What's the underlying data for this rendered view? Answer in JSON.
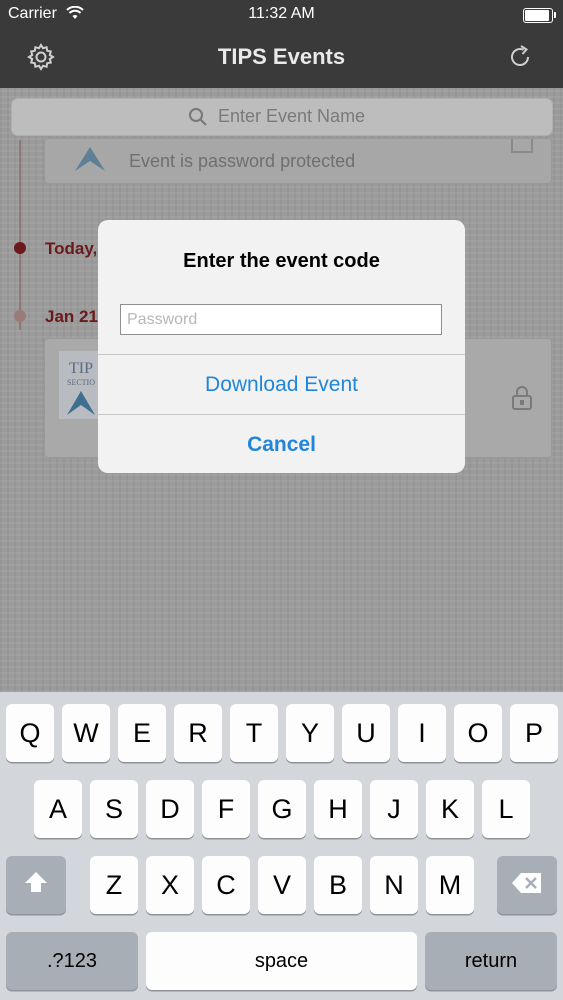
{
  "status_bar": {
    "carrier": "Carrier",
    "time": "11:32 AM"
  },
  "nav": {
    "title": "TIPS Events",
    "left_icon": "gear-icon",
    "right_icon": "refresh-icon"
  },
  "search": {
    "placeholder": "Enter Event Name"
  },
  "list": {
    "card_status": "Event is password protected",
    "section_today": "Today,",
    "section_jan": "Jan 21"
  },
  "alert": {
    "title": "Enter the event code",
    "password_placeholder": "Password",
    "password_value": "",
    "primary_button": "Download Event",
    "cancel_button": "Cancel",
    "accent_color": "#2186d9"
  },
  "keyboard": {
    "row1": [
      "Q",
      "W",
      "E",
      "R",
      "T",
      "Y",
      "U",
      "I",
      "O",
      "P"
    ],
    "row2": [
      "A",
      "S",
      "D",
      "F",
      "G",
      "H",
      "J",
      "K",
      "L"
    ],
    "row3": [
      "Z",
      "X",
      "C",
      "V",
      "B",
      "N",
      "M"
    ],
    "mode_key": ".?123",
    "space_key": "space",
    "return_key": "return"
  }
}
